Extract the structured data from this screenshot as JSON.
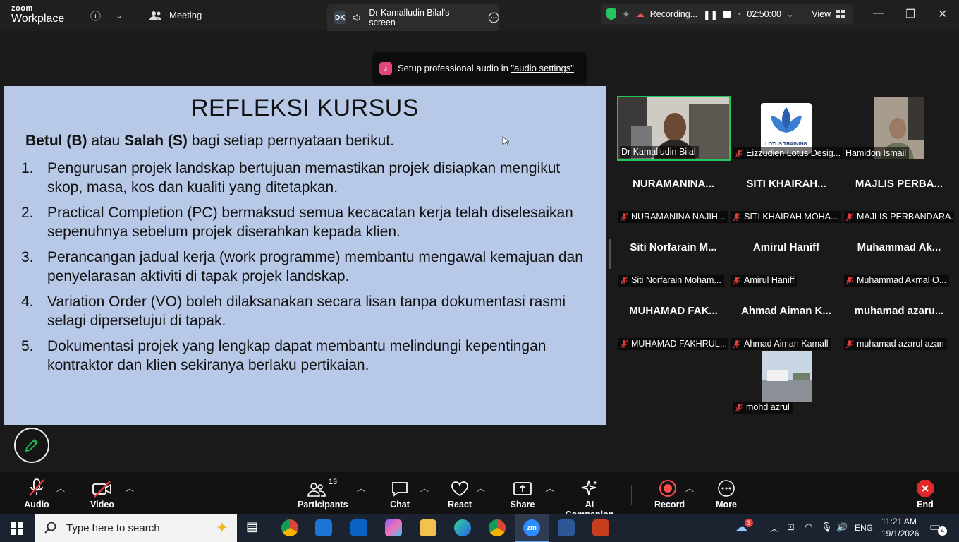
{
  "titlebar": {
    "brand_top": "zoom",
    "brand_bottom": "Workplace",
    "meeting_label": "Meeting",
    "screen_tab_initials": "DK",
    "screen_tab_label": "Dr Kamalludin Bilal's screen",
    "recording_label": "Recording...",
    "timer": "02:50:00",
    "view_label": "View"
  },
  "notice": {
    "text": "Setup professional audio in ",
    "link": "\"audio settings\""
  },
  "slide": {
    "title": "REFLEKSI KURSUS",
    "instruction_b": "Betul (B)",
    "instruction_mid": " atau ",
    "instruction_s": "Salah (S)",
    "instruction_end": " bagi setiap pernyataan berikut.",
    "items": [
      {
        "num": "1.",
        "text": "Pengurusan projek landskap bertujuan memastikan projek disiapkan mengikut skop, masa, kos dan kualiti yang ditetapkan."
      },
      {
        "num": "2.",
        "text": "Practical Completion (PC) bermaksud semua kecacatan kerja telah diselesaikan sepenuhnya sebelum projek diserahkan kepada klien."
      },
      {
        "num": "3.",
        "text": "Perancangan jadual kerja (work programme) membantu mengawal kemajuan dan penyelarasan aktiviti di tapak projek landskap."
      },
      {
        "num": "4.",
        "text": "Variation Order (VO) boleh dilaksanakan secara lisan tanpa dokumentasi rasmi selagi dipersetujui di tapak."
      },
      {
        "num": "5.",
        "text": "Dokumentasi projek yang lengkap dapat membantu melindungi kepentingan kontraktor dan klien sekiranya berlaku pertikaian."
      }
    ]
  },
  "participants": [
    {
      "big": "",
      "label": "Dr Kamalludin Bilal",
      "muted": false
    },
    {
      "big": "",
      "label": "Eizzudien Lotus Desig...",
      "muted": true,
      "logo_text": "LOTUS TRAINING"
    },
    {
      "big": "",
      "label": "Hamidon Ismail",
      "muted": false
    },
    {
      "big": "NURAMANINA...",
      "label": "NURAMANINA NAJIH...",
      "muted": true
    },
    {
      "big": "SITI KHAIRAH...",
      "label": "SITI KHAIRAH MOHA...",
      "muted": true
    },
    {
      "big": "MAJLIS PERBA...",
      "label": "MAJLIS PERBANDARA...",
      "muted": true
    },
    {
      "big": "Siti Norfarain M...",
      "label": "Siti Norfarain Moham...",
      "muted": true
    },
    {
      "big": "Amirul Haniff",
      "label": "Amirul Haniff",
      "muted": true
    },
    {
      "big": "Muhammad Ak...",
      "label": "Muhammad Akmal O...",
      "muted": true
    },
    {
      "big": "MUHAMAD FAK...",
      "label": "MUHAMAD FAKHRUL...",
      "muted": true
    },
    {
      "big": "Ahmad Aiman K...",
      "label": "Ahmad Aiman Kamall",
      "muted": true
    },
    {
      "big": "muhamad azaru...",
      "label": "muhamad azarul azan",
      "muted": true
    },
    {
      "big": "",
      "label": "mohd azrul",
      "muted": true
    }
  ],
  "toolbar": {
    "audio": "Audio",
    "video": "Video",
    "participants": "Participants",
    "participants_count": "13",
    "chat": "Chat",
    "react": "React",
    "share": "Share",
    "ai": "AI Companion",
    "record": "Record",
    "more": "More",
    "end": "End"
  },
  "taskbar": {
    "search_placeholder": "Type here to search",
    "language": "ENG",
    "time": "11:21 AM",
    "date": "19/1/2026",
    "weather_badge": "3",
    "notif_count": "4"
  },
  "colors": {
    "accent_green": "#22c55e",
    "record_red": "#ff4f4f",
    "slide_bg": "#b8c9e8"
  }
}
